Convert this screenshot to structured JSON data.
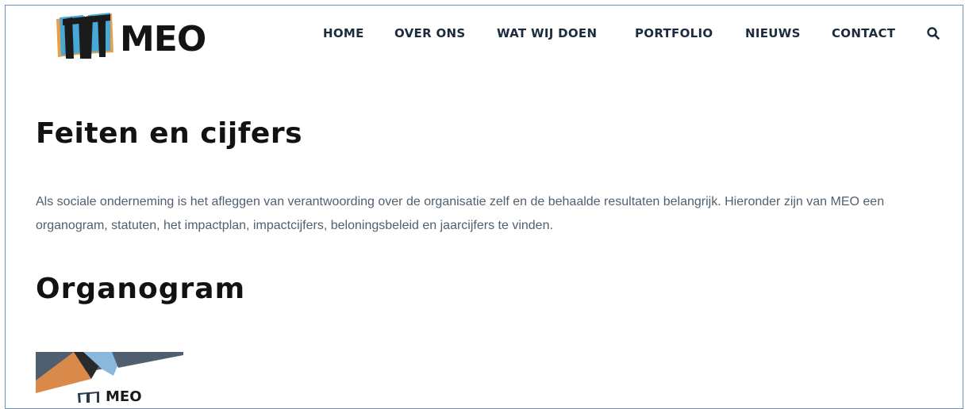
{
  "brand": {
    "name": "MEO",
    "icon": "book-logo-icon"
  },
  "nav": {
    "items": [
      {
        "label": "HOME"
      },
      {
        "label": "OVER ONS"
      },
      {
        "label": "WAT WIJ DOEN"
      },
      {
        "label": "PORTFOLIO"
      },
      {
        "label": "NIEUWS"
      },
      {
        "label": "CONTACT"
      }
    ],
    "search_icon": "search-icon"
  },
  "main": {
    "title": "Feiten en cijfers",
    "intro": "Als sociale onderneming is het afleggen van verantwoording over de organisatie zelf en de behaalde resultaten belangrijk. Hieronder zijn van MEO een organogram, statuten, het impactplan, impactcijfers, beloningsbeleid en jaarcijfers te vinden.",
    "section_title": "Organogram",
    "thumbnail": {
      "logo_text": "MEO"
    }
  },
  "colors": {
    "nav_text": "#1d2b3e",
    "body_text": "#51606f",
    "heading": "#121212",
    "accent_blue": "#4aa8d8",
    "accent_orange": "#d98a4a",
    "slate": "#4f5f70"
  }
}
